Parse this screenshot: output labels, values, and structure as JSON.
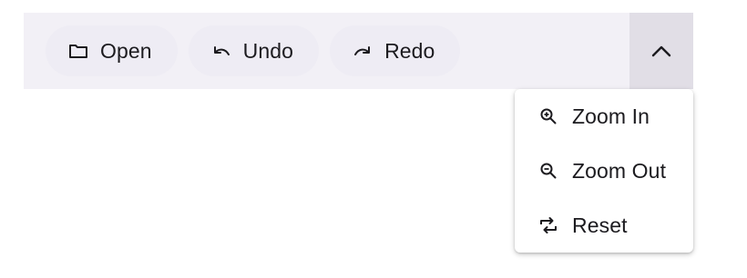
{
  "toolbar": {
    "buttons": [
      {
        "label": "Open",
        "icon": "folder-icon"
      },
      {
        "label": "Undo",
        "icon": "undo-icon"
      },
      {
        "label": "Redo",
        "icon": "redo-icon"
      }
    ],
    "overflow_icon": "chevron-up-icon",
    "colors": {
      "bar_background": "#f2f0f6",
      "overflow_active": "#e1dee6",
      "text": "#1c1b1f"
    }
  },
  "overflow_menu": {
    "items": [
      {
        "label": "Zoom In",
        "icon": "zoom-in-icon"
      },
      {
        "label": "Zoom Out",
        "icon": "zoom-out-icon"
      },
      {
        "label": "Reset",
        "icon": "reset-icon"
      }
    ]
  }
}
